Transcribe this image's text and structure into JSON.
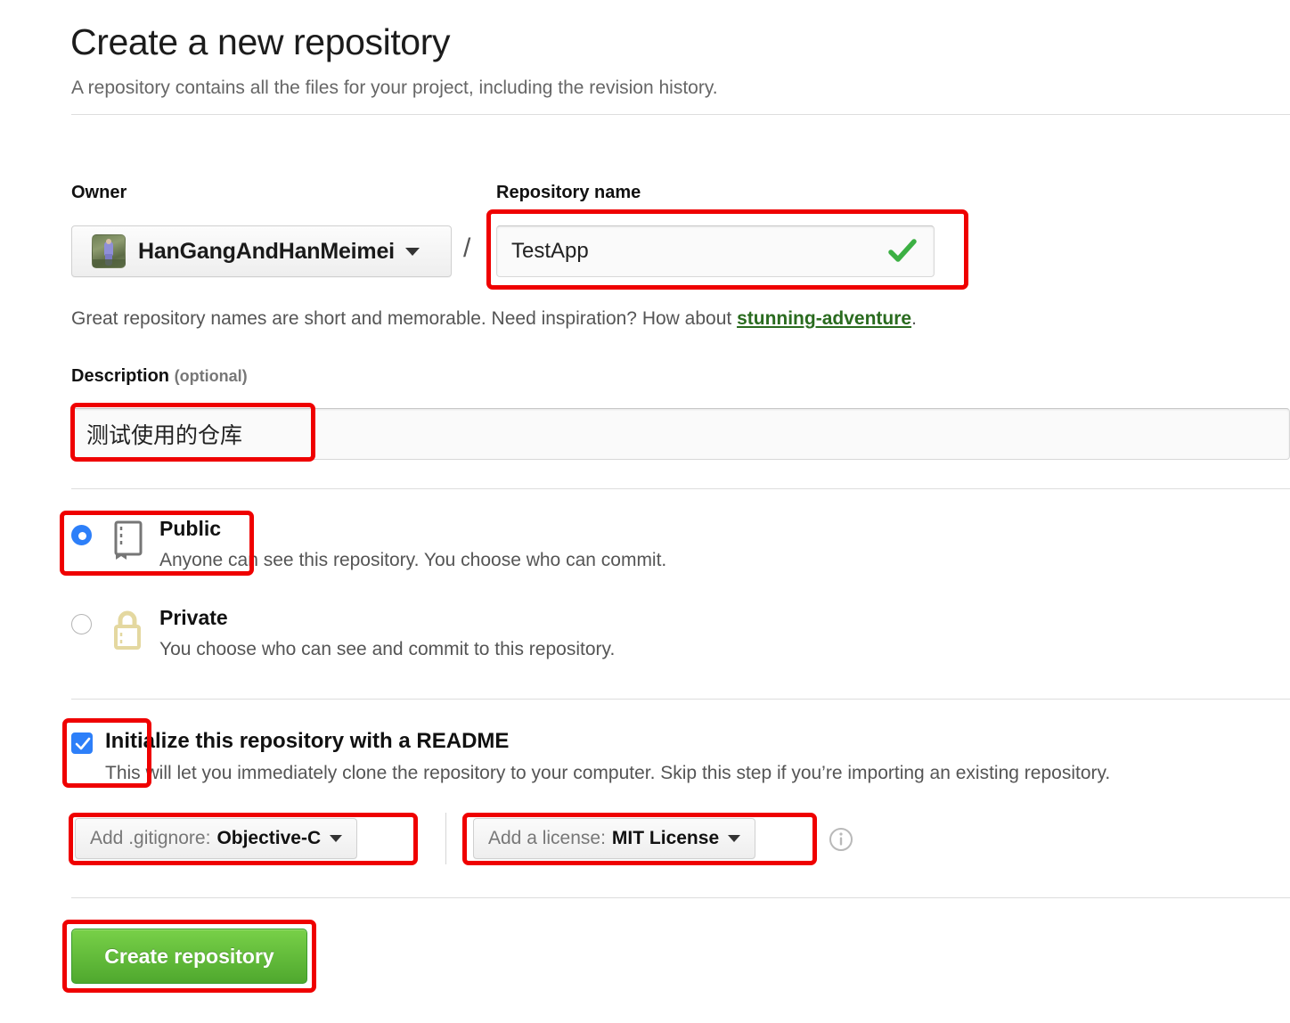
{
  "header": {
    "title": "Create a new repository",
    "subtitle": "A repository contains all the files for your project, including the revision history."
  },
  "owner": {
    "label": "Owner",
    "name": "HanGangAndHanMeimei",
    "avatar_icon": "user-avatar-image",
    "caret_icon": "chevron-down-icon"
  },
  "separator": "/",
  "repo_name": {
    "label": "Repository name",
    "value": "TestApp",
    "valid_icon": "check-mark-icon",
    "valid_color": "#3cb043"
  },
  "hint": {
    "before": "Great repository names are short and memorable. Need inspiration? How about ",
    "suggestion": "stunning-adventure",
    "after": ".",
    "suggestion_color": "#2a6b1f"
  },
  "description": {
    "label": "Description",
    "optional": "(optional)",
    "value": "测试使用的仓库"
  },
  "visibility": {
    "public": {
      "title": "Public",
      "desc": "Anyone can see this repository. You choose who can commit.",
      "selected": true,
      "icon": "repo-book-icon",
      "icon_color": "#767676"
    },
    "private": {
      "title": "Private",
      "desc": "You choose who can see and commit to this repository.",
      "selected": false,
      "icon": "lock-icon",
      "icon_color": "#e4d8a0"
    },
    "radio_selected_color": "#2d7ff9"
  },
  "readme": {
    "title": "Initialize this repository with a README",
    "desc": "This will let you immediately clone the repository to your computer. Skip this step if you’re importing an existing repository.",
    "checked": true,
    "checkbox_color": "#2d7ff9",
    "check_icon": "check-mark-icon"
  },
  "gitignore": {
    "prefix": "Add .gitignore:",
    "value": "Objective-C",
    "caret_icon": "chevron-down-icon"
  },
  "license": {
    "prefix": "Add a license:",
    "value": "MIT License",
    "caret_icon": "chevron-down-icon",
    "info_icon": "info-circle-icon"
  },
  "submit": {
    "label": "Create repository",
    "color": "#5bb832"
  },
  "annotations": {
    "color": "#ef0000",
    "boxes": [
      "repository-name-field",
      "description-field",
      "public-option",
      "readme-checkbox",
      "gitignore-dropdown",
      "license-dropdown",
      "create-repository-button"
    ]
  }
}
